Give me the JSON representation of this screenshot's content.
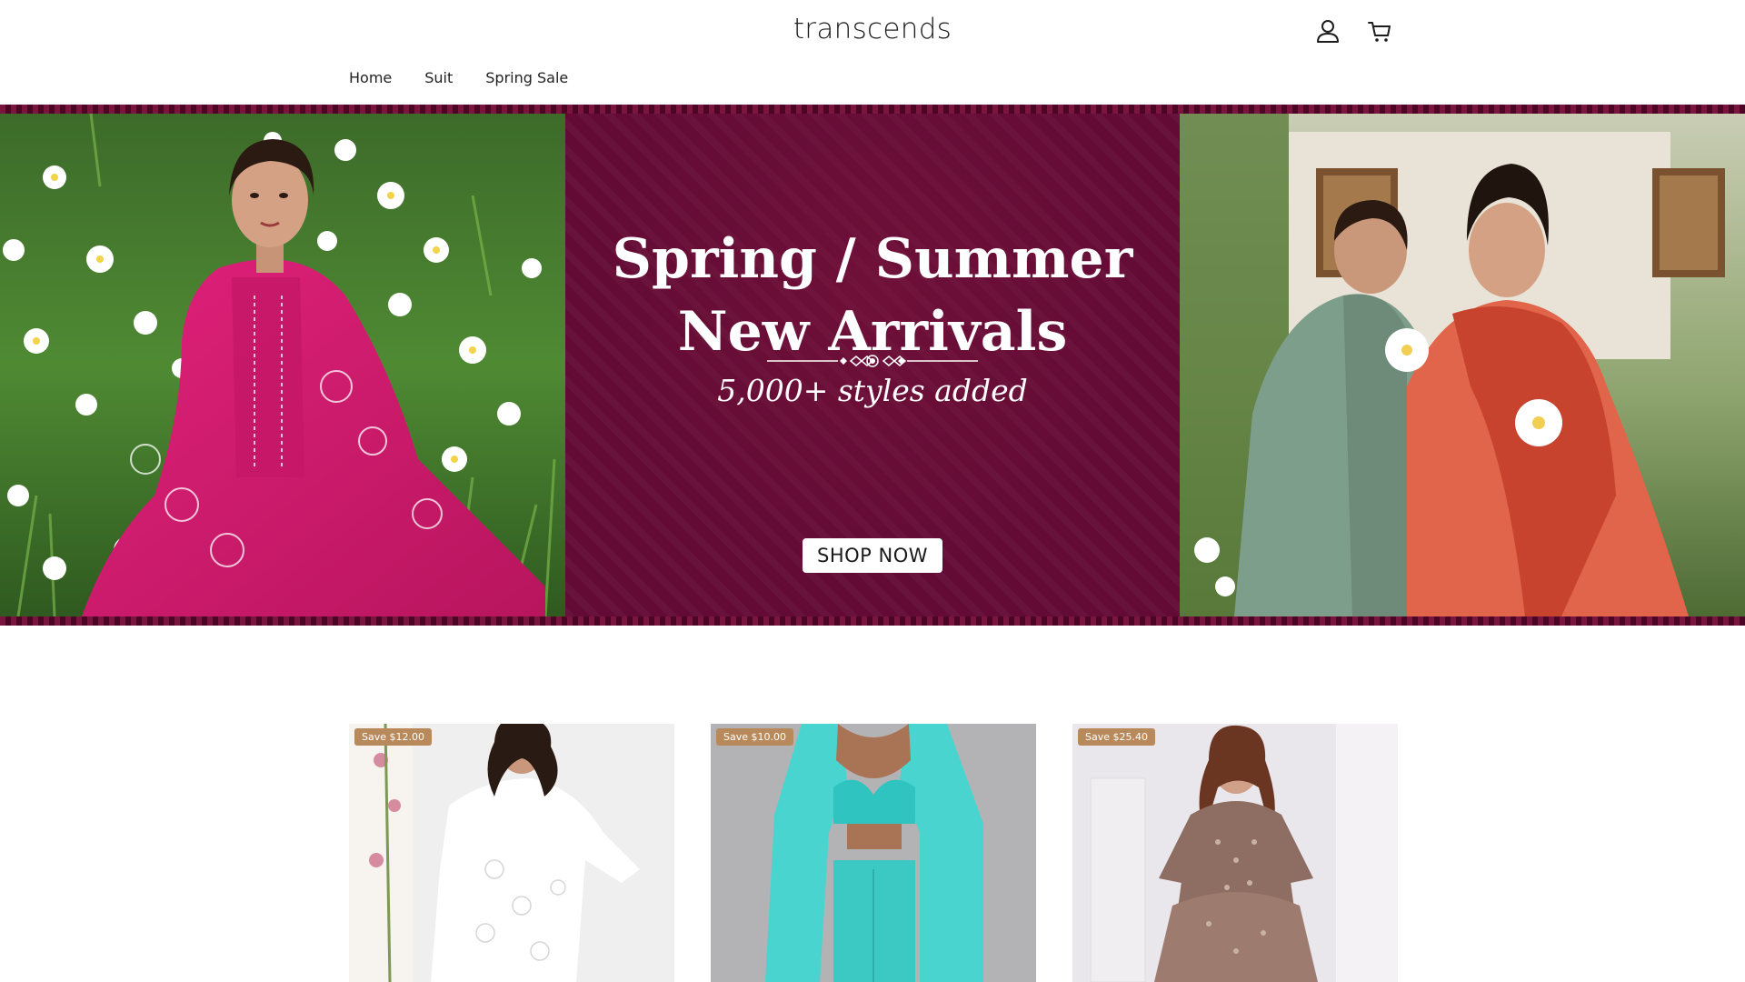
{
  "header": {
    "logo": "transcends",
    "icons": [
      "account-icon",
      "cart-icon"
    ]
  },
  "nav": {
    "items": [
      "Home",
      "Suit",
      "Spring Sale"
    ]
  },
  "hero": {
    "title_line1": "Spring / Summer",
    "title_line2": "New Arrivals",
    "subtitle": "5,000+ styles added",
    "cta": "SHOP NOW",
    "colors": {
      "banner": "#630b35",
      "trim": "#4a0624",
      "cta_bg": "#ffffff"
    }
  },
  "products": [
    {
      "badge": "Save $12.00"
    },
    {
      "badge": "Save $10.00"
    },
    {
      "badge": "Save $25.40"
    }
  ],
  "colors": {
    "badge": "#b8895a"
  }
}
